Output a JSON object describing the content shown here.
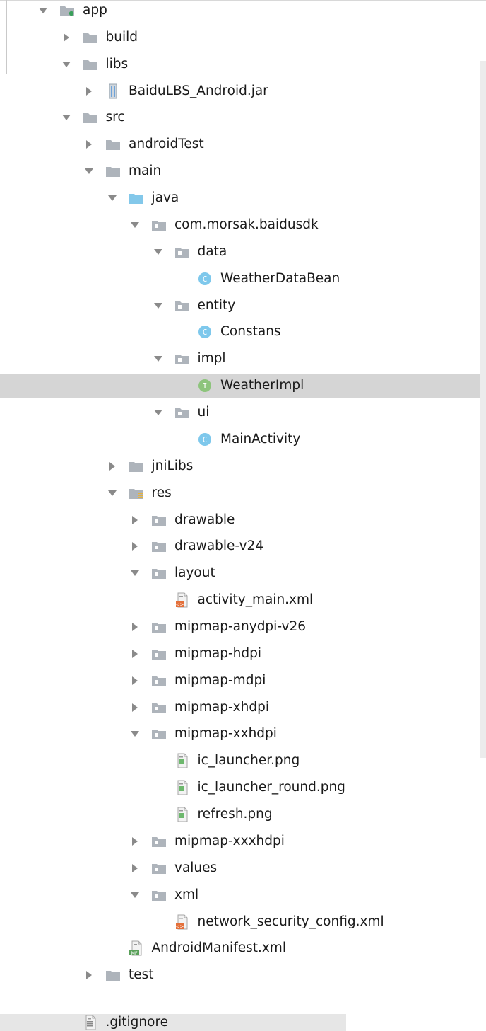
{
  "tree": {
    "items": [
      {
        "label": "app",
        "depth": 0,
        "arrow": "expanded",
        "icon": "module-folder-icon"
      },
      {
        "label": "build",
        "depth": 1,
        "arrow": "collapsed",
        "icon": "folder-icon"
      },
      {
        "label": "libs",
        "depth": 1,
        "arrow": "expanded",
        "icon": "folder-icon"
      },
      {
        "label": "BaiduLBS_Android.jar",
        "depth": 2,
        "arrow": "collapsed",
        "icon": "jar-icon"
      },
      {
        "label": "src",
        "depth": 1,
        "arrow": "expanded",
        "icon": "folder-icon"
      },
      {
        "label": "androidTest",
        "depth": 2,
        "arrow": "collapsed",
        "icon": "folder-icon"
      },
      {
        "label": "main",
        "depth": 2,
        "arrow": "expanded",
        "icon": "folder-icon"
      },
      {
        "label": "java",
        "depth": 3,
        "arrow": "expanded",
        "icon": "source-folder-icon"
      },
      {
        "label": "com.morsak.baidusdk",
        "depth": 4,
        "arrow": "expanded",
        "icon": "package-icon"
      },
      {
        "label": "data",
        "depth": 5,
        "arrow": "expanded",
        "icon": "package-icon"
      },
      {
        "label": "WeatherDataBean",
        "depth": 6,
        "arrow": "none",
        "icon": "class-icon"
      },
      {
        "label": "entity",
        "depth": 5,
        "arrow": "expanded",
        "icon": "package-icon"
      },
      {
        "label": "Constans",
        "depth": 6,
        "arrow": "none",
        "icon": "class-icon"
      },
      {
        "label": "impl",
        "depth": 5,
        "arrow": "expanded",
        "icon": "package-icon"
      },
      {
        "label": "WeatherImpl",
        "depth": 6,
        "arrow": "none",
        "icon": "interface-icon",
        "selected": true
      },
      {
        "label": "ui",
        "depth": 5,
        "arrow": "expanded",
        "icon": "package-icon"
      },
      {
        "label": "MainActivity",
        "depth": 6,
        "arrow": "none",
        "icon": "class-icon"
      },
      {
        "label": "jniLibs",
        "depth": 3,
        "arrow": "collapsed",
        "icon": "folder-icon"
      },
      {
        "label": "res",
        "depth": 3,
        "arrow": "expanded",
        "icon": "resources-folder-icon"
      },
      {
        "label": "drawable",
        "depth": 4,
        "arrow": "collapsed",
        "icon": "package-icon"
      },
      {
        "label": "drawable-v24",
        "depth": 4,
        "arrow": "collapsed",
        "icon": "package-icon"
      },
      {
        "label": "layout",
        "depth": 4,
        "arrow": "expanded",
        "icon": "package-icon"
      },
      {
        "label": "activity_main.xml",
        "depth": 5,
        "arrow": "none",
        "icon": "xml-file-icon"
      },
      {
        "label": "mipmap-anydpi-v26",
        "depth": 4,
        "arrow": "collapsed",
        "icon": "package-icon"
      },
      {
        "label": "mipmap-hdpi",
        "depth": 4,
        "arrow": "collapsed",
        "icon": "package-icon"
      },
      {
        "label": "mipmap-mdpi",
        "depth": 4,
        "arrow": "collapsed",
        "icon": "package-icon"
      },
      {
        "label": "mipmap-xhdpi",
        "depth": 4,
        "arrow": "collapsed",
        "icon": "package-icon"
      },
      {
        "label": "mipmap-xxhdpi",
        "depth": 4,
        "arrow": "expanded",
        "icon": "package-icon"
      },
      {
        "label": "ic_launcher.png",
        "depth": 5,
        "arrow": "none",
        "icon": "image-file-icon"
      },
      {
        "label": "ic_launcher_round.png",
        "depth": 5,
        "arrow": "none",
        "icon": "image-file-icon"
      },
      {
        "label": "refresh.png",
        "depth": 5,
        "arrow": "none",
        "icon": "image-file-icon"
      },
      {
        "label": "mipmap-xxxhdpi",
        "depth": 4,
        "arrow": "collapsed",
        "icon": "package-icon"
      },
      {
        "label": "values",
        "depth": 4,
        "arrow": "collapsed",
        "icon": "package-icon"
      },
      {
        "label": "xml",
        "depth": 4,
        "arrow": "expanded",
        "icon": "package-icon"
      },
      {
        "label": "network_security_config.xml",
        "depth": 5,
        "arrow": "none",
        "icon": "xml-file-icon"
      },
      {
        "label": "AndroidManifest.xml",
        "depth": 3,
        "arrow": "none",
        "icon": "manifest-file-icon"
      },
      {
        "label": "test",
        "depth": 2,
        "arrow": "collapsed",
        "icon": "folder-icon"
      },
      {
        "label": ".gitignore",
        "depth": 1,
        "arrow": "none",
        "icon": "text-file-icon"
      }
    ]
  },
  "colors": {
    "selection": "#d5d5d5",
    "folder": "#aeb4bb",
    "source_folder": "#83c8ea",
    "class_icon": "#7ec8ec",
    "interface_icon": "#8dc47c",
    "xml_badge": "#e4703a"
  }
}
